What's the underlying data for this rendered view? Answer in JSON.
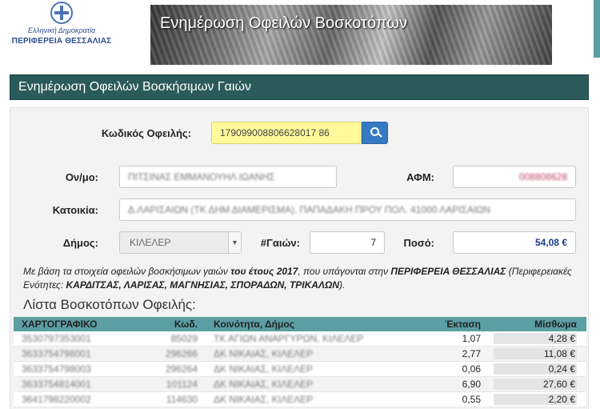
{
  "header": {
    "logo_line1": "Ελληνική Δημοκρατία",
    "logo_line2": "ΠΕΡΙΦΕΡΕΙΑ ΘΕΣΣΑΛΙΑΣ",
    "banner_title": "Ενημέρωση Οφειλών Βοσκοτόπων"
  },
  "section": {
    "title": "Ενημέρωση Οφειλών Βοσκήσιμων Γαιών"
  },
  "form": {
    "code_label": "Κωδικός Οφειλής:",
    "code_value": "179099008806628017 86",
    "name_label": "Ον/μο:",
    "name_value": "ΠΙΤΣΙΝΑΣ ΕΜΜΑΝΟΥΗΛ ΙΩΑΝΗΣ",
    "afm_label": "ΑΦΜ:",
    "afm_value": "008808628",
    "residence_label": "Κατοικία:",
    "residence_value": "Δ.ΛΑΡΙΣΑΙΩΝ (ΤΚ ΔΗΜ ΔΙΑΜΕΡΙΣΜΑ), ΠΑΠΑΔΑΚΗ ΠΡΟΥ ΠΟΛ. 41000 ΛΑΡΙΣΑΙΩΝ",
    "municipality_label": "Δήμος:",
    "municipality_value": "ΚΙΛΕΛΕΡ",
    "lands_label": "#Γαιών:",
    "lands_value": "7",
    "amount_label": "Ποσό:",
    "amount_value": "54,08 €"
  },
  "note": {
    "part1": "Με βάση τα στοιχεία οφειλών βοσκήσιμων γαιών ",
    "bold1": "του έτους 2017",
    "part2": ", που υπάγονται στην ",
    "bold2": "ΠΕΡΙΦΕΡΕΙΑ ΘΕΣΣΑΛΙΑΣ",
    "part3": " (Περιφερειακές Ενότητες: ",
    "bold3": "ΚΑΡΔΙΤΣΑΣ, ΛΑΡΙΣΑΣ, ΜΑΓΝΗΣΙΑΣ, ΣΠΟΡΑΔΩΝ, ΤΡΙΚΑΛΩΝ",
    "part4": ")."
  },
  "list": {
    "title": "Λίστα Βοσκοτόπων Οφειλής:",
    "columns": {
      "map": "ΧΑΡΤΟΓΡΑΦΙΚΟ",
      "code": "Κωδ.",
      "community": "Κοινότητα, Δήμος",
      "area": "Έκταση",
      "rent": "Μίσθωμα"
    },
    "rows": [
      {
        "map": "3530797353001",
        "code": "85029",
        "community": "ΤΚ ΑΓΙΩΝ ΑΝΑΡΓΥΡΩΝ, ΚΙΛΕΛΕΡ",
        "area": "1,07",
        "rent": "4,28 €"
      },
      {
        "map": "3633754798001",
        "code": "296266",
        "community": "ΔΚ ΝΙΚΑΙΑΣ, ΚΙΛΕΛΕΡ",
        "area": "2,77",
        "rent": "11,08 €"
      },
      {
        "map": "3633754798003",
        "code": "296264",
        "community": "ΔΚ ΝΙΚΑΙΑΣ, ΚΙΛΕΛΕΡ",
        "area": "0,06",
        "rent": "0,24 €"
      },
      {
        "map": "3633754814001",
        "code": "101124",
        "community": "ΔΚ ΝΙΚΑΙΑΣ, ΚΙΛΕΛΕΡ",
        "area": "6,90",
        "rent": "27,60 €"
      },
      {
        "map": "3641798220002",
        "code": "114630",
        "community": "ΔΚ ΝΙΚΑΙΑΣ, ΚΙΛΕΛΕΡ",
        "area": "0,55",
        "rent": "2,20 €"
      }
    ]
  }
}
